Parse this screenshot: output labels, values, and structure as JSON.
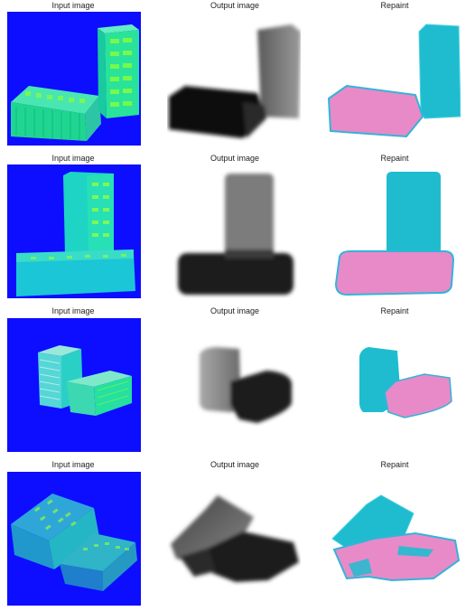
{
  "columns": [
    {
      "title": "Input image"
    },
    {
      "title": "Output image"
    },
    {
      "title": "Repaint"
    }
  ],
  "colors": {
    "input_background": "#0d0dff",
    "brick_green": "#2ee6a0",
    "output_background": "#ffffff",
    "repaint_cyan": "#1fbcd0",
    "repaint_pink": "#e88ac8"
  },
  "rows": [
    {
      "scene": "flat-brick-left-with-upright-brick-right"
    },
    {
      "scene": "upright-brick-on-top-of-flat-brick"
    },
    {
      "scene": "upright-brick-behind-angled-flat-brick"
    },
    {
      "scene": "two-diagonal-bricks-overlapping"
    }
  ]
}
